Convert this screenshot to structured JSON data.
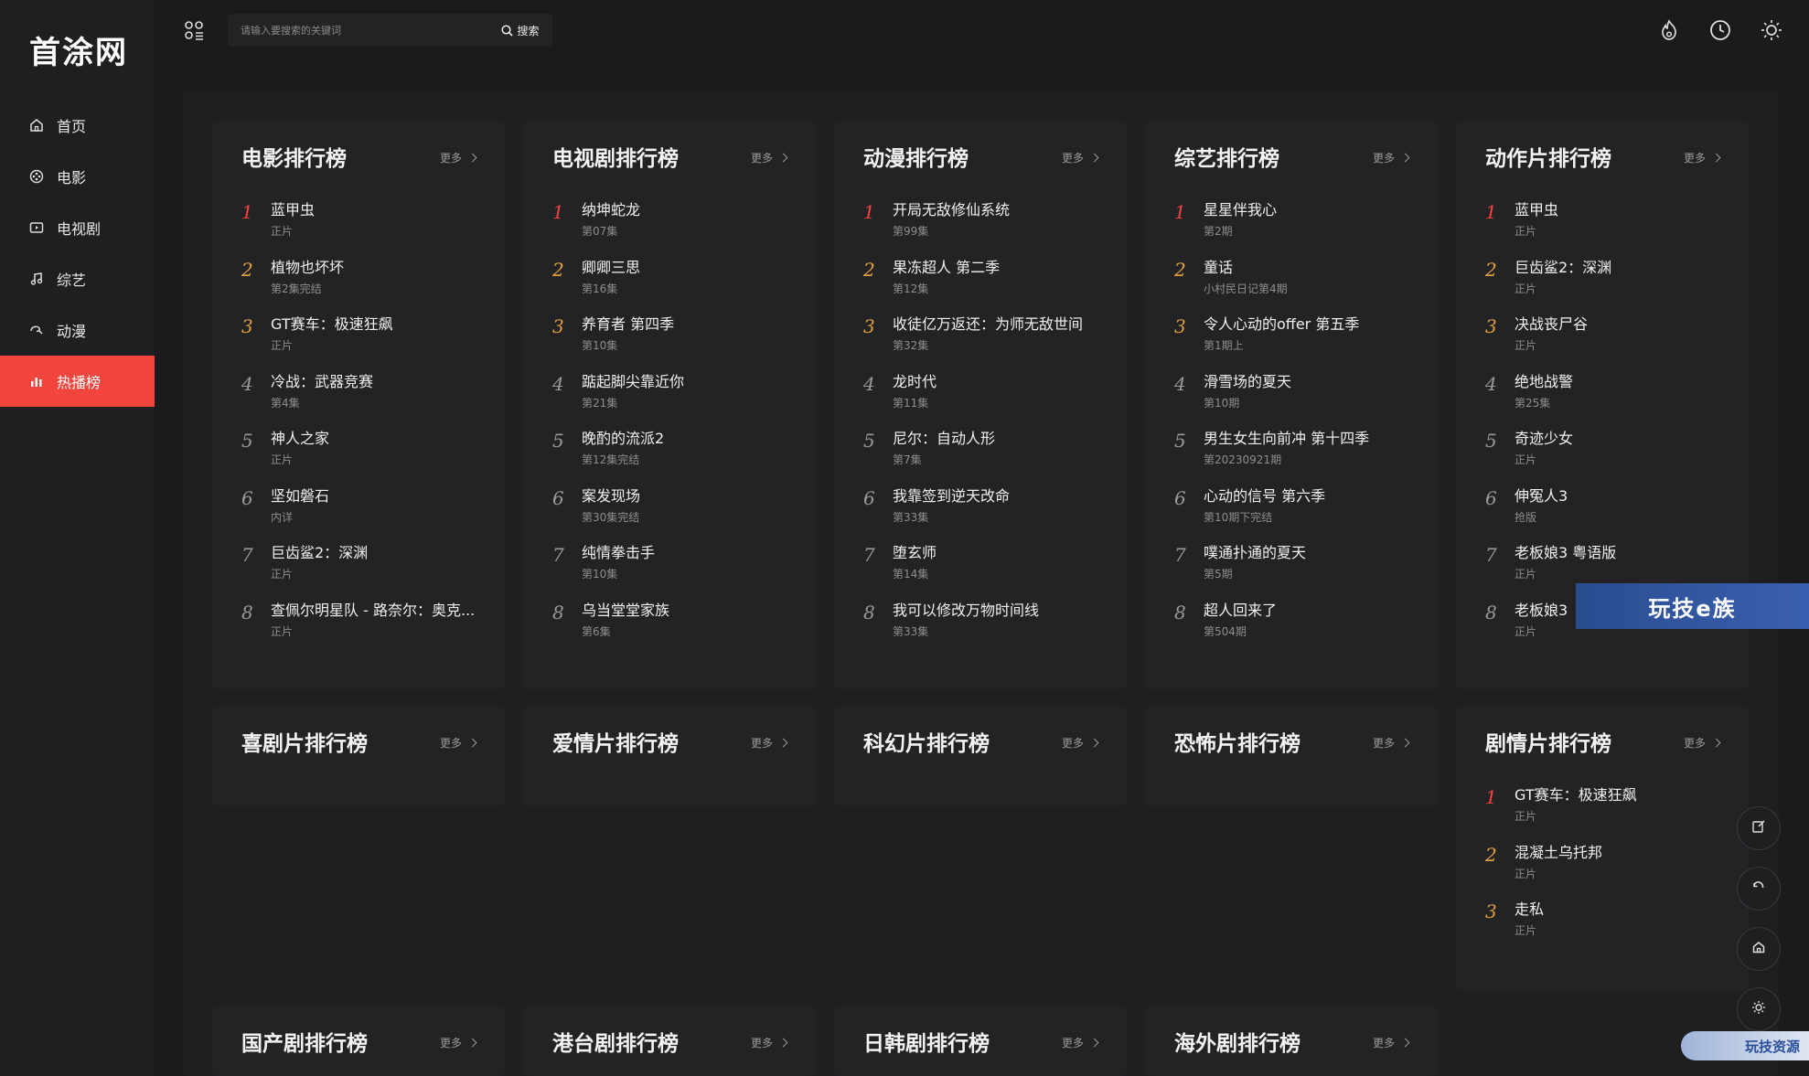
{
  "site": {
    "logo": "首涂网"
  },
  "nav": [
    {
      "label": "首页",
      "icon": "home-icon"
    },
    {
      "label": "电影",
      "icon": "film-icon"
    },
    {
      "label": "电视剧",
      "icon": "tv-icon"
    },
    {
      "label": "综艺",
      "icon": "music-icon"
    },
    {
      "label": "动漫",
      "icon": "anime-icon"
    },
    {
      "label": "热播榜",
      "icon": "chart-icon",
      "active": true
    }
  ],
  "search": {
    "placeholder": "请输入要搜索的关键词",
    "button": "搜索"
  },
  "topbar_icons": [
    "fire-icon",
    "history-icon",
    "sun-icon"
  ],
  "more_label": "更多",
  "cards": [
    {
      "title": "电影排行榜",
      "items": [
        {
          "name": "蓝甲虫",
          "sub": "正片"
        },
        {
          "name": "植物也坏坏",
          "sub": "第2集完结"
        },
        {
          "name": "GT赛车：极速狂飙",
          "sub": "正片"
        },
        {
          "name": "冷战：武器竞赛",
          "sub": "第4集"
        },
        {
          "name": "神人之家",
          "sub": "正片"
        },
        {
          "name": "坚如磐石",
          "sub": "内详"
        },
        {
          "name": "巨齿鲨2：深渊",
          "sub": "正片"
        },
        {
          "name": "查佩尔明星队 - 路奈尔：奥克...",
          "sub": "正片"
        }
      ]
    },
    {
      "title": "电视剧排行榜",
      "items": [
        {
          "name": "纳坤蛇龙",
          "sub": "第07集"
        },
        {
          "name": "卿卿三思",
          "sub": "第16集"
        },
        {
          "name": "养育者 第四季",
          "sub": "第10集"
        },
        {
          "name": "踮起脚尖靠近你",
          "sub": "第21集"
        },
        {
          "name": "晚酌的流派2",
          "sub": "第12集完结"
        },
        {
          "name": "案发现场",
          "sub": "第30集完结"
        },
        {
          "name": "纯情拳击手",
          "sub": "第10集"
        },
        {
          "name": "乌当堂堂家族",
          "sub": "第6集"
        }
      ]
    },
    {
      "title": "动漫排行榜",
      "items": [
        {
          "name": "开局无敌修仙系统",
          "sub": "第99集"
        },
        {
          "name": "果冻超人 第二季",
          "sub": "第12集"
        },
        {
          "name": "收徒亿万返还：为师无敌世间",
          "sub": "第32集"
        },
        {
          "name": "龙时代",
          "sub": "第11集"
        },
        {
          "name": "尼尔：自动人形",
          "sub": "第7集"
        },
        {
          "name": "我靠签到逆天改命",
          "sub": "第33集"
        },
        {
          "name": "堕玄师",
          "sub": "第14集"
        },
        {
          "name": "我可以修改万物时间线",
          "sub": "第33集"
        }
      ]
    },
    {
      "title": "综艺排行榜",
      "items": [
        {
          "name": "星星伴我心",
          "sub": "第2期"
        },
        {
          "name": "童话",
          "sub": "小村民日记第4期"
        },
        {
          "name": "令人心动的offer 第五季",
          "sub": "第1期上"
        },
        {
          "name": "滑雪场的夏天",
          "sub": "第10期"
        },
        {
          "name": "男生女生向前冲 第十四季",
          "sub": "第20230921期"
        },
        {
          "name": "心动的信号 第六季",
          "sub": "第10期下完结"
        },
        {
          "name": "噗通扑通的夏天",
          "sub": "第5期"
        },
        {
          "name": "超人回来了",
          "sub": "第504期"
        }
      ]
    },
    {
      "title": "动作片排行榜",
      "items": [
        {
          "name": "蓝甲虫",
          "sub": "正片"
        },
        {
          "name": "巨齿鲨2：深渊",
          "sub": "正片"
        },
        {
          "name": "决战丧尸谷",
          "sub": "正片"
        },
        {
          "name": "绝地战警",
          "sub": "第25集"
        },
        {
          "name": "奇迹少女",
          "sub": "正片"
        },
        {
          "name": "伸冤人3",
          "sub": "抢版"
        },
        {
          "name": "老板娘3 粤语版",
          "sub": "正片"
        },
        {
          "name": "老板娘3",
          "sub": "正片"
        }
      ]
    },
    {
      "title": "喜剧片排行榜",
      "items": []
    },
    {
      "title": "爱情片排行榜",
      "items": []
    },
    {
      "title": "科幻片排行榜",
      "items": []
    },
    {
      "title": "恐怖片排行榜",
      "items": []
    },
    {
      "title": "剧情片排行榜",
      "items": [
        {
          "name": "GT赛车：极速狂飙",
          "sub": "正片"
        },
        {
          "name": "混凝土乌托邦",
          "sub": "正片"
        },
        {
          "name": "走私",
          "sub": "正片"
        }
      ]
    },
    {
      "title": "国产剧排行榜",
      "items": []
    },
    {
      "title": "港台剧排行榜",
      "items": []
    },
    {
      "title": "日韩剧排行榜",
      "items": []
    },
    {
      "title": "海外剧排行榜",
      "items": []
    }
  ],
  "watermarks": {
    "main": "玩技e族",
    "corner": "玩技资源"
  },
  "float_buttons": [
    "edit-icon",
    "refresh-icon",
    "home-icon",
    "sun-icon"
  ]
}
